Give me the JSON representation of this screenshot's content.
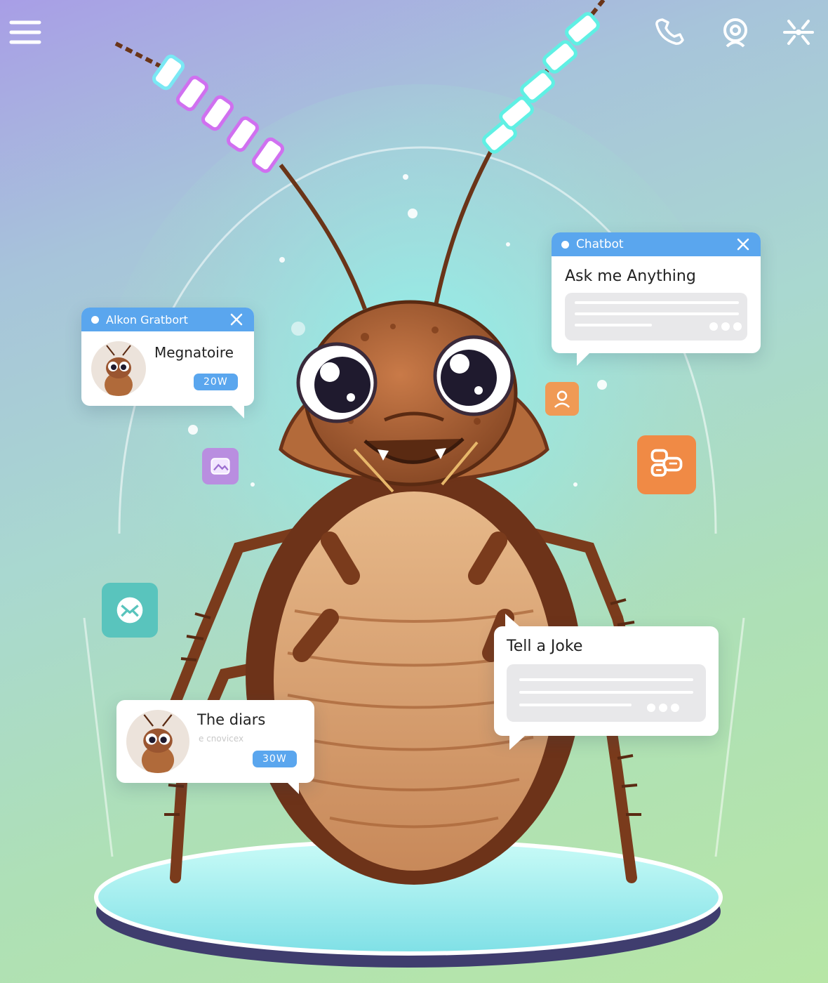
{
  "topbar": {
    "menu_icon": "hamburger-menu-icon",
    "call_icon": "phone-icon",
    "webcam_icon": "webcam-icon",
    "network_icon": "network-icon"
  },
  "cards": {
    "left_top": {
      "header": "Alkon Gratbort",
      "title": "Megnatoire",
      "badge": "20W"
    },
    "right_top": {
      "header": "Chatbot",
      "title": "Ask me Anything"
    },
    "right_bottom": {
      "title": "Tell a Joke"
    },
    "left_bottom": {
      "title": "The diars",
      "subtitle": "e cnovicex",
      "badge": "30W"
    }
  },
  "colors": {
    "accent": "#5aa6ee",
    "header_text": "#ffffff",
    "mail_icon_bg": "#59c4bd",
    "chat_icon_bg": "#f08a45",
    "contact_icon_bg": "#f09a55",
    "gallery_icon_bg": "#b98ee0"
  }
}
